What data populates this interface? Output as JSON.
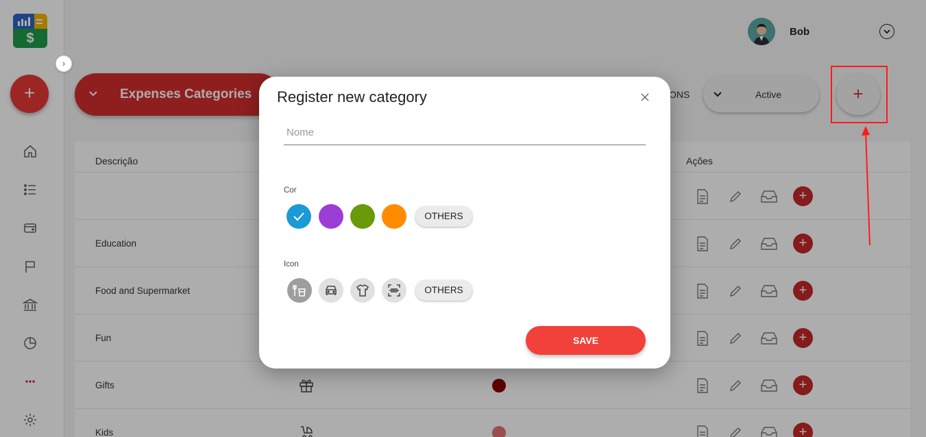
{
  "user": {
    "name": "Bob"
  },
  "toolbar": {
    "category_type": "Expenses Categories",
    "status_filter": "Active",
    "partial_label": "ONS",
    "add_label": "+"
  },
  "table": {
    "headers": {
      "description": "Descrição",
      "actions": "Ações"
    },
    "rows": [
      {
        "description": "",
        "icon": "",
        "color": ""
      },
      {
        "description": "Education",
        "icon": "",
        "color": ""
      },
      {
        "description": "Food and Supermarket",
        "icon": "",
        "color": ""
      },
      {
        "description": "Fun",
        "icon": "",
        "color": ""
      },
      {
        "description": "Gifts",
        "icon": "gift-icon",
        "color": "#8b0000"
      },
      {
        "description": "Kids",
        "icon": "stroller-icon",
        "color": "#e57373"
      }
    ]
  },
  "modal": {
    "title": "Register new category",
    "name_placeholder": "Nome",
    "color_label": "Cor",
    "colors": [
      "#1a9ad6",
      "#9b3ed6",
      "#6a9a0a",
      "#ff8c00"
    ],
    "selected_color": "#1a9ad6",
    "icon_label": "Icon",
    "icons": [
      "restaurant-icon",
      "car-icon",
      "shirt-icon",
      "scan-icon"
    ],
    "selected_icon": "restaurant-icon",
    "others_label": "OTHERS",
    "save_label": "SAVE"
  },
  "colors": {
    "brand_red": "#d32f2f",
    "save_red": "#f2403a",
    "annotation_red": "#ff1a1a"
  }
}
